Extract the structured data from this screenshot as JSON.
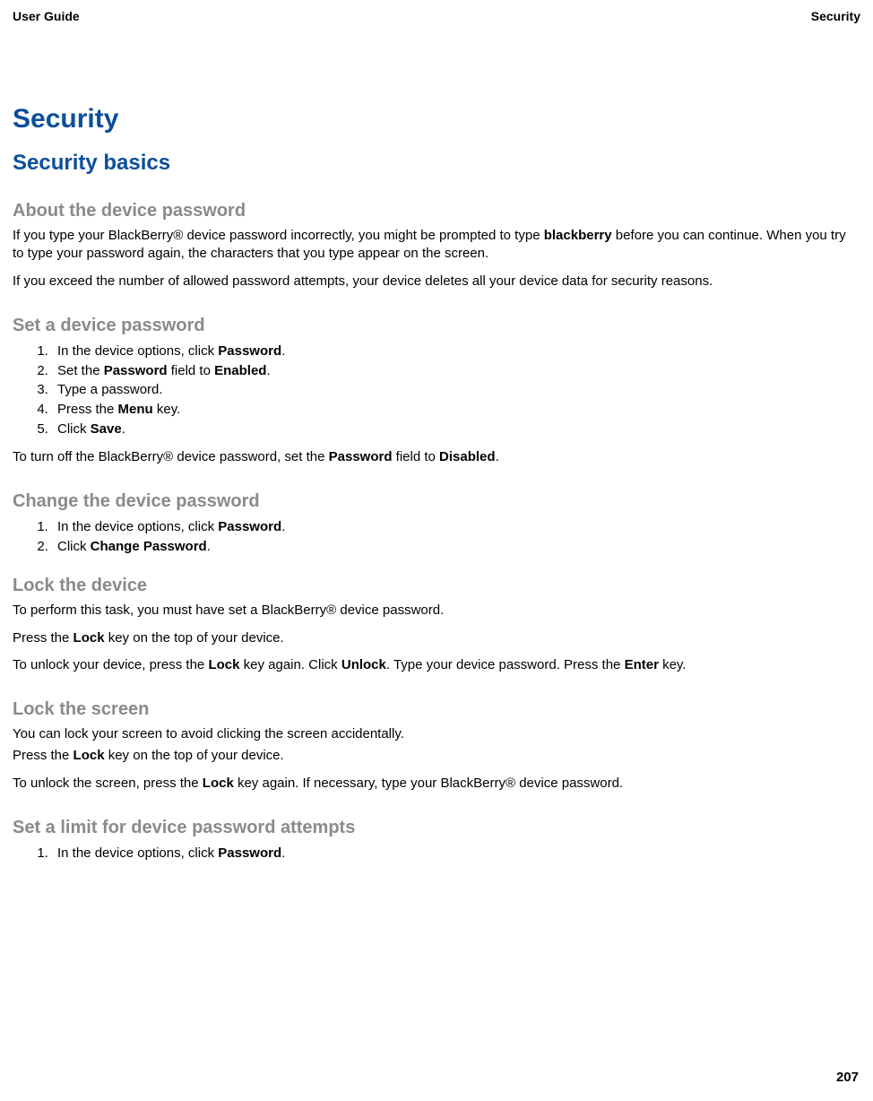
{
  "header": {
    "left": "User Guide",
    "right": "Security"
  },
  "title": "Security",
  "h2_basics": "Security basics",
  "about_pw": {
    "heading": "About the device password",
    "p1_a": "If you type your BlackBerry® device password incorrectly, you might be prompted to type ",
    "p1_bold": "blackberry",
    "p1_b": " before you can continue. When you try to type your password again, the characters that you type appear on the screen.",
    "p2": "If you exceed the number of allowed password attempts, your device deletes all your device data for security reasons."
  },
  "set_pw": {
    "heading": "Set a device password",
    "s1_a": "In the device options, click ",
    "s1_bold": "Password",
    "s1_b": ".",
    "s2_a": "Set the ",
    "s2_bold1": "Password",
    "s2_b": " field to ",
    "s2_bold2": "Enabled",
    "s2_c": ".",
    "s3": "Type a password.",
    "s4_a": "Press the ",
    "s4_bold": "Menu",
    "s4_b": " key.",
    "s5_a": "Click ",
    "s5_bold": "Save",
    "s5_b": ".",
    "note_a": "To turn off the BlackBerry® device password, set the ",
    "note_bold1": "Password",
    "note_b": " field to ",
    "note_bold2": "Disabled",
    "note_c": "."
  },
  "change_pw": {
    "heading": "Change the device password",
    "s1_a": "In the device options, click ",
    "s1_bold": "Password",
    "s1_b": ".",
    "s2_a": "Click ",
    "s2_bold": "Change Password",
    "s2_b": "."
  },
  "lock_device": {
    "heading": "Lock the device",
    "p1": "To perform this task, you must have set a BlackBerry® device password.",
    "p2_a": "Press the ",
    "p2_bold": "Lock",
    "p2_b": " key on the top of your device.",
    "p3_a": "To unlock your device, press the ",
    "p3_bold1": "Lock",
    "p3_b": " key again. Click ",
    "p3_bold2": "Unlock",
    "p3_c": ". Type your device password. Press the ",
    "p3_bold3": "Enter",
    "p3_d": " key."
  },
  "lock_screen": {
    "heading": "Lock the screen",
    "p1": "You can lock your screen to avoid clicking the screen accidentally.",
    "p2_a": "Press the ",
    "p2_bold": "Lock",
    "p2_b": " key on the top of your device.",
    "p3_a": "To unlock the screen, press the ",
    "p3_bold": "Lock",
    "p3_b": " key again. If necessary, type your BlackBerry® device password."
  },
  "limit": {
    "heading": "Set a limit for device password attempts",
    "s1_a": "In the device options, click ",
    "s1_bold": "Password",
    "s1_b": "."
  },
  "page_number": "207"
}
